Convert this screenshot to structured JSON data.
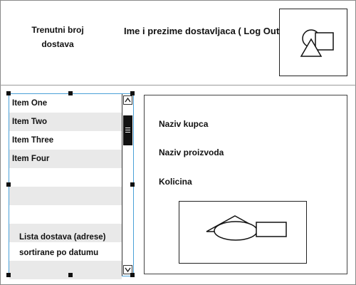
{
  "header": {
    "delivery_count_line1": "Trenutni broj",
    "delivery_count_line2": "dostava",
    "driver_logout": "Ime i prezime dostavljaca ( Log Out )"
  },
  "deliveries": {
    "items": [
      "Item One",
      "Item Two",
      "Item Three",
      "Item Four"
    ],
    "caption_line1": "Lista dostava (adrese)",
    "caption_line2": "sortirane po datumu"
  },
  "details": {
    "customer_label": "Naziv kupca",
    "product_label": "Naziv proizvoda",
    "quantity_label": "Kolicina"
  },
  "icons": {
    "avatar": "image-placeholder-icon",
    "product": "image-placeholder-icon"
  }
}
